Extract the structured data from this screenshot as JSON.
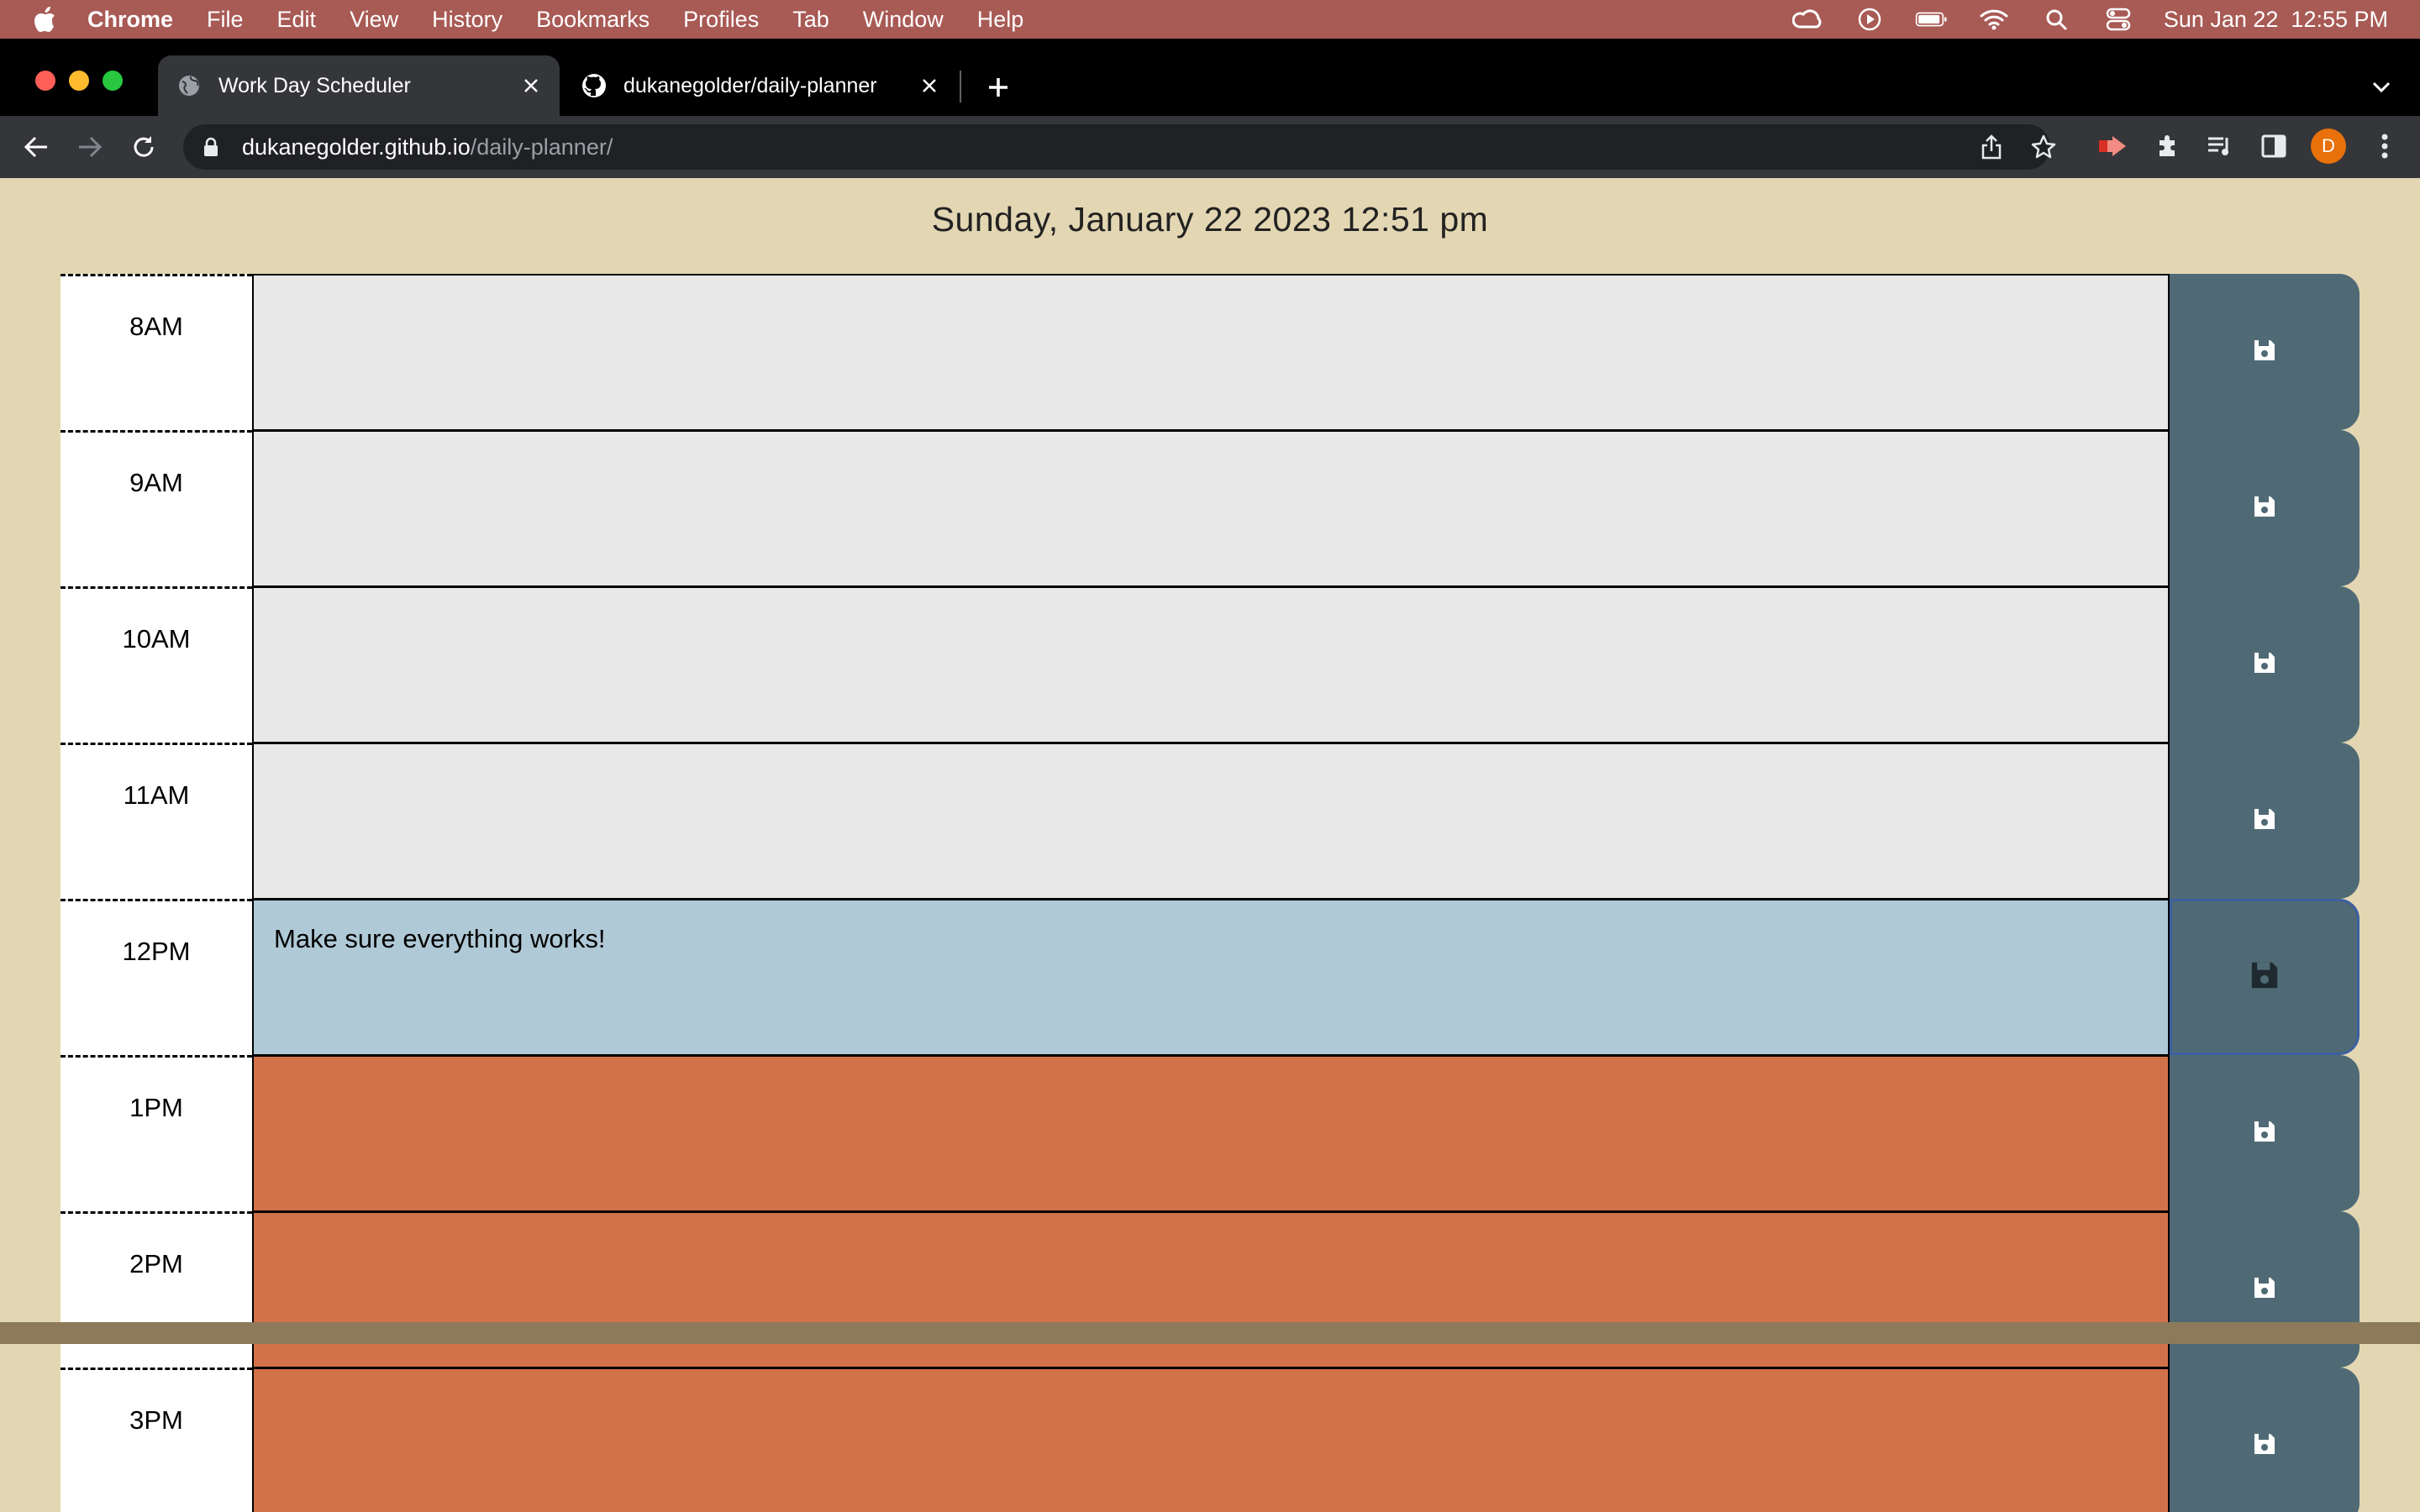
{
  "menubar": {
    "app_name": "Chrome",
    "items": [
      "File",
      "Edit",
      "View",
      "History",
      "Bookmarks",
      "Profiles",
      "Tab",
      "Window",
      "Help"
    ],
    "datetime": "Sun Jan 22  12:55 PM"
  },
  "tabs": [
    {
      "title": "Work Day Scheduler",
      "icon": "globe-icon",
      "active": true
    },
    {
      "title": "dukanegolder/daily-planner",
      "icon": "github-icon",
      "active": false
    }
  ],
  "address_bar": {
    "host": "dukanegolder.github.io",
    "path": "/daily-planner/"
  },
  "profile_initial": "D",
  "page": {
    "current_day": "Sunday, January 22 2023 12:51 pm",
    "time_blocks": [
      {
        "hour": "8AM",
        "text": "",
        "state": "past"
      },
      {
        "hour": "9AM",
        "text": "",
        "state": "past"
      },
      {
        "hour": "10AM",
        "text": "",
        "state": "past"
      },
      {
        "hour": "11AM",
        "text": "",
        "state": "past"
      },
      {
        "hour": "12PM",
        "text": "Make sure everything works!",
        "state": "present"
      },
      {
        "hour": "1PM",
        "text": "",
        "state": "future"
      },
      {
        "hour": "2PM",
        "text": "",
        "state": "future"
      },
      {
        "hour": "3PM",
        "text": "",
        "state": "future"
      }
    ]
  },
  "colors": {
    "past": "#e8e8e8",
    "present": "#b0c9d6",
    "future": "#d2724b",
    "save_button": "#4f6a75",
    "page_background": "#e3d6b3"
  }
}
